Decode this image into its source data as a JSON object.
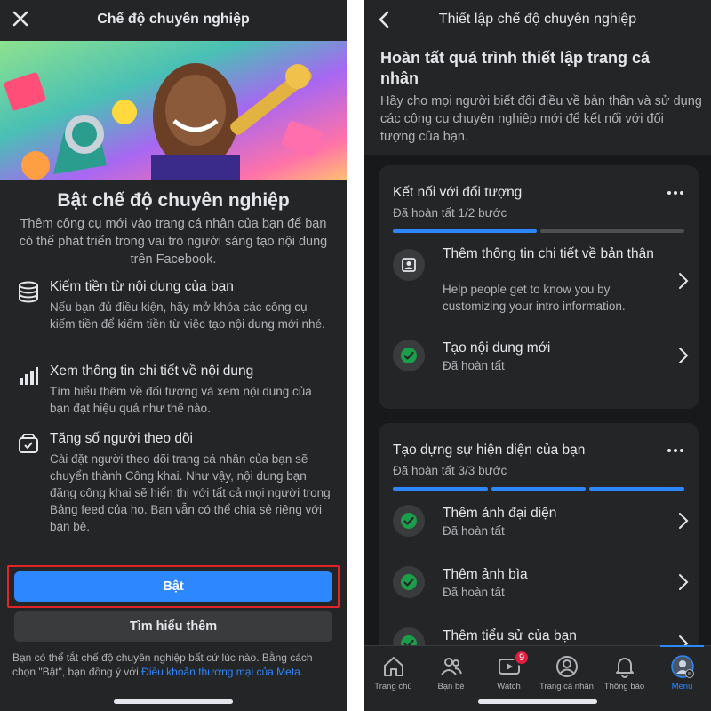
{
  "left": {
    "header_title": "Chế độ chuyên nghiệp",
    "heading": "Bật chế độ chuyên nghiệp",
    "intro": "Thêm công cụ mới vào trang cá nhân của bạn để bạn có thể phát triển trong vai trò người sáng tạo nội dung trên Facebook.",
    "features": [
      {
        "icon": "coins-stack-icon",
        "title": "Kiếm tiền từ nội dung của bạn",
        "desc": "Nếu bạn đủ điều kiện, hãy mở khóa các công cụ kiếm tiền để kiếm tiền từ việc tạo nội dung mới nhé."
      },
      {
        "icon": "bar-chart-icon",
        "title": "Xem thông tin chi tiết về nội dung",
        "desc": "Tìm hiểu thêm về đối tượng và xem nội dung của bạn đạt hiệu quả như thế nào."
      },
      {
        "icon": "follower-box-icon",
        "title": "Tăng số người theo dõi",
        "desc": "Cài đặt người theo dõi trang cá nhân của bạn sẽ chuyển thành Công khai. Như vậy, nội dung bạn đăng công khai sẽ hiển thị với tất cả mọi người trong Bảng feed của họ. Bạn vẫn có thể chia sẻ riêng với bạn bè."
      }
    ],
    "primary_button": "Bật",
    "secondary_button": "Tìm hiểu thêm",
    "footer_text": "Bạn có thể tắt chế độ chuyên nghiệp bất cứ lúc nào. Bằng cách chọn \"Bật\", bạn đồng ý với ",
    "footer_link": "Điều khoản thương mại của Meta",
    "footer_end": ".",
    "highlight_color": "#e0242a",
    "accent_color": "#2d88ff"
  },
  "right": {
    "header_title": "Thiết lập chế độ chuyên nghiệp",
    "heading": "Hoàn tất quá trình thiết lập trang cá nhân",
    "intro": "Hãy cho mọi người biết đôi điều về bản thân và sử dụng các công cụ chuyên nghiệp mới để kết nối với đối tượng của bạn.",
    "cards": [
      {
        "title": "Kết nối với đối tượng",
        "subtitle": "Đã hoàn tất 1/2 bước",
        "steps_done": 1,
        "steps_total": 2,
        "tasks": [
          {
            "icon": "profile-card-icon",
            "title": "Thêm thông tin chi tiết về bản thân",
            "sub": "Help people get to know you by customizing your intro information.",
            "done": false
          },
          {
            "icon": "check-circle-icon",
            "title": "Tạo nội dung mới",
            "sub": "Đã hoàn tất",
            "done": true
          }
        ]
      },
      {
        "title": "Tạo dựng sự hiện diện của bạn",
        "subtitle": "Đã hoàn tất 3/3 bước",
        "steps_done": 3,
        "steps_total": 3,
        "tasks": [
          {
            "icon": "check-circle-icon",
            "title": "Thêm ảnh đại diện",
            "sub": "Đã hoàn tất",
            "done": true
          },
          {
            "icon": "check-circle-icon",
            "title": "Thêm ảnh bìa",
            "sub": "Đã hoàn tất",
            "done": true
          },
          {
            "icon": "check-circle-icon",
            "title": "Thêm tiểu sử của bạn",
            "sub": "",
            "done": true
          }
        ]
      }
    ],
    "tabs": [
      {
        "label": "Trang chủ",
        "icon": "home-icon",
        "active": false
      },
      {
        "label": "Bạn bè",
        "icon": "friends-icon",
        "active": false
      },
      {
        "label": "Watch",
        "icon": "watch-icon",
        "active": false,
        "badge": "9"
      },
      {
        "label": "Trang cá nhân",
        "icon": "profile-icon",
        "active": false
      },
      {
        "label": "Thông báo",
        "icon": "bell-icon",
        "active": false
      },
      {
        "label": "Menu",
        "icon": "menu-avatar-icon",
        "active": true
      }
    ],
    "success_color": "#1a9e4a",
    "badge_color": "#e41e3f"
  }
}
